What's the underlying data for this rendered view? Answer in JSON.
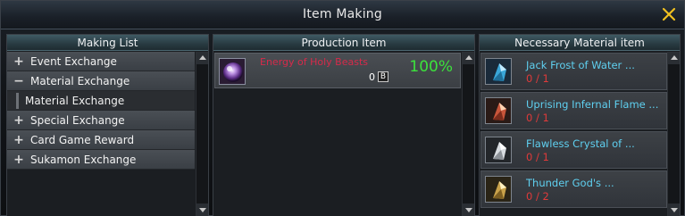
{
  "window": {
    "title": "Item Making",
    "close_icon": "close-x-icon"
  },
  "making_list": {
    "header": "Making List",
    "items": [
      {
        "type": "category",
        "sign": "+",
        "label": "Event Exchange"
      },
      {
        "type": "category",
        "sign": "−",
        "label": "Material Exchange"
      },
      {
        "type": "sub",
        "label": "Material Exchange"
      },
      {
        "type": "category",
        "sign": "+",
        "label": "Special Exchange"
      },
      {
        "type": "category",
        "sign": "+",
        "label": "Card Game Reward"
      },
      {
        "type": "category",
        "sign": "+",
        "label": "Sukamon Exchange"
      }
    ]
  },
  "production": {
    "header": "Production Item",
    "item": {
      "name": "Energy of Holy Beasts",
      "percent": "100%",
      "count": "0",
      "badge": "B",
      "icon": "purple-orb-icon"
    }
  },
  "materials": {
    "header": "Necessary Material item",
    "items": [
      {
        "name": "Jack Frost of Water ...",
        "qty": "0 / 1",
        "icon": "blue-crystal-icon",
        "color": "#3aa6d8"
      },
      {
        "name": "Uprising Infernal Flame ...",
        "qty": "0 / 1",
        "icon": "red-crystal-icon",
        "color": "#c8553a"
      },
      {
        "name": "Flawless Crystal of ...",
        "qty": "0 / 1",
        "icon": "white-crystal-icon",
        "color": "#d8dce0"
      },
      {
        "name": "Thunder God's ...",
        "qty": "0 / 2",
        "icon": "gold-crystal-icon",
        "color": "#c9a24a"
      }
    ]
  },
  "colors": {
    "header_bg": "#2a3d44",
    "product_name": "#d62a4a",
    "percent": "#3ce23c",
    "material_name": "#5fd0f0",
    "material_qty": "#e03a3a",
    "close_icon": "#f0c020"
  }
}
